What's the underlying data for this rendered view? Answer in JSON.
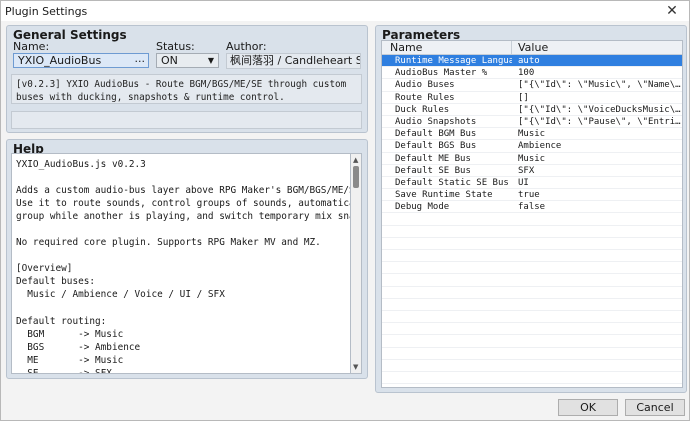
{
  "window": {
    "title": "Plugin Settings",
    "close_glyph": "✕"
  },
  "general": {
    "title": "General Settings",
    "name_label": "Name:",
    "name_value": "YXIO_AudioBus",
    "name_ellipsis": "...",
    "status_label": "Status:",
    "status_value": "ON",
    "author_label": "Author:",
    "author_value": "枫间落羽 / Candleheart Studio",
    "description": "[v0.2.3] YXIO AudioBus - Route BGM/BGS/ME/SE through custom buses with ducking, snapshots & runtime control."
  },
  "help": {
    "title": "Help",
    "lines": [
      "YXIO_AudioBus.js v0.2.3",
      "",
      "Adds a custom audio-bus layer above RPG Maker's BGM/BGS/ME/SE system.",
      "Use it to route sounds, control groups of sounds, automatically duck one",
      "group while another is playing, and switch temporary mix snapshots.",
      "",
      "No required core plugin. Supports RPG Maker MV and MZ.",
      "",
      "[Overview]",
      "Default buses:",
      "  Music / Ambience / Voice / UI / SFX",
      "",
      "Default routing:",
      "  BGM      -> Music",
      "  BGS      -> Ambience",
      "  ME       -> Music",
      "  SE       -> SFX"
    ]
  },
  "parameters": {
    "title": "Parameters",
    "col_name": "Name",
    "col_value": "Value",
    "rows": [
      {
        "name": "Runtime Message Language",
        "value": "auto"
      },
      {
        "name": "AudioBus Master %",
        "value": "100"
      },
      {
        "name": "Audio Buses",
        "value": "[\"{\\\"Id\\\": \\\"Music\\\", \\\"Name\\\": ..."
      },
      {
        "name": "Route Rules",
        "value": "[]"
      },
      {
        "name": "Duck Rules",
        "value": "[\"{\\\"Id\\\": \\\"VoiceDucksMusic\\\", ..."
      },
      {
        "name": "Audio Snapshots",
        "value": "[\"{\\\"Id\\\": \\\"Pause\\\", \\\"Entries\\..."
      },
      {
        "name": "Default BGM Bus",
        "value": "Music"
      },
      {
        "name": "Default BGS Bus",
        "value": "Ambience"
      },
      {
        "name": "Default ME Bus",
        "value": "Music"
      },
      {
        "name": "Default SE Bus",
        "value": "SFX"
      },
      {
        "name": "Default Static SE Bus",
        "value": "UI"
      },
      {
        "name": "Save Runtime State",
        "value": "true"
      },
      {
        "name": "Debug Mode",
        "value": "false"
      }
    ],
    "selected_index": 0
  },
  "buttons": {
    "ok": "OK",
    "cancel": "Cancel"
  },
  "colors": {
    "selection": "#2f7fe0",
    "group_bg": "#d9e1ea"
  }
}
